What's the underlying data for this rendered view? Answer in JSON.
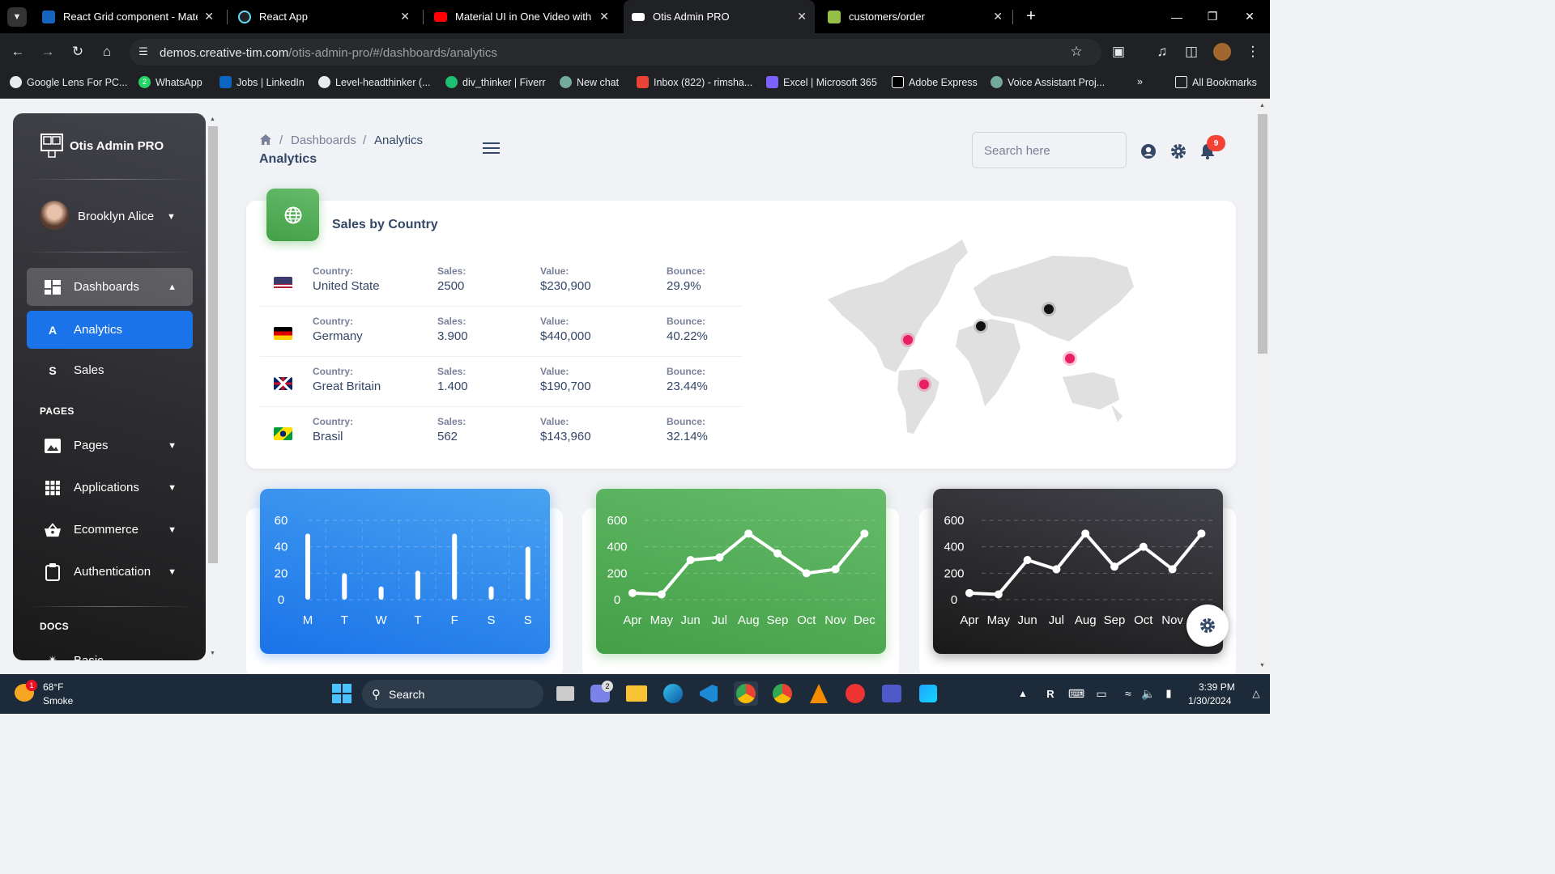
{
  "browser": {
    "tabs": [
      {
        "title": "React Grid component - Materia",
        "active": false
      },
      {
        "title": "React App",
        "active": false
      },
      {
        "title": "Material UI in One Video with R",
        "active": false
      },
      {
        "title": "Otis Admin PRO",
        "active": true
      },
      {
        "title": "customers/order",
        "active": false
      }
    ],
    "url_host": "demos.creative-tim.com",
    "url_path": "/otis-admin-pro/#/dashboards/analytics",
    "bookmarks": [
      "Google Lens For PC...",
      "WhatsApp",
      "Jobs | LinkedIn",
      "Level-headthinker (...",
      "div_thinker | Fiverr",
      "New chat",
      "Inbox (822) - rimsha...",
      "Excel | Microsoft 365",
      "Adobe Express",
      "Voice Assistant Proj..."
    ],
    "all_bookmarks": "All Bookmarks",
    "whatsapp_badge": "2"
  },
  "sidenav": {
    "brand": "Otis Admin PRO",
    "user": "Brooklyn Alice",
    "dashboards": "Dashboards",
    "sub": [
      {
        "letter": "A",
        "label": "Analytics"
      },
      {
        "letter": "S",
        "label": "Sales"
      }
    ],
    "pages_heading": "PAGES",
    "pages": [
      "Pages",
      "Applications",
      "Ecommerce",
      "Authentication"
    ],
    "docs_heading": "DOCS",
    "docs_first": "Basic"
  },
  "header": {
    "crumb_dashboards": "Dashboards",
    "crumb_sep": "/",
    "crumb_current": "Analytics",
    "title": "Analytics",
    "search_placeholder": "Search here",
    "notification_count": "9"
  },
  "sales_by_country": {
    "title": "Sales by Country",
    "labels": {
      "country": "Country:",
      "sales": "Sales:",
      "value": "Value:",
      "bounce": "Bounce:"
    },
    "rows": [
      {
        "country": "United State",
        "sales": "2500",
        "value": "$230,900",
        "bounce": "29.9%"
      },
      {
        "country": "Germany",
        "sales": "3.900",
        "value": "$440,000",
        "bounce": "40.22%"
      },
      {
        "country": "Great Britain",
        "sales": "1.400",
        "value": "$190,700",
        "bounce": "23.44%"
      },
      {
        "country": "Brasil",
        "sales": "562",
        "value": "$143,960",
        "bounce": "32.14%"
      }
    ]
  },
  "chart_data": [
    {
      "type": "bar",
      "categories": [
        "M",
        "T",
        "W",
        "T",
        "F",
        "S",
        "S"
      ],
      "values": [
        50,
        20,
        10,
        22,
        50,
        10,
        40
      ],
      "ylim": [
        0,
        60
      ],
      "yticks": [
        0,
        20,
        40,
        60
      ],
      "color": "#1a73e8"
    },
    {
      "type": "line",
      "categories": [
        "Apr",
        "May",
        "Jun",
        "Jul",
        "Aug",
        "Sep",
        "Oct",
        "Nov",
        "Dec"
      ],
      "values": [
        50,
        40,
        300,
        320,
        500,
        350,
        200,
        230,
        500
      ],
      "ylim": [
        0,
        600
      ],
      "yticks": [
        0,
        200,
        400,
        600
      ],
      "color": "#4caf50"
    },
    {
      "type": "line",
      "categories": [
        "Apr",
        "May",
        "Jun",
        "Jul",
        "Aug",
        "Sep",
        "Oct",
        "Nov",
        "Dec"
      ],
      "values": [
        50,
        40,
        300,
        230,
        500,
        250,
        400,
        230,
        500
      ],
      "ylim": [
        0,
        600
      ],
      "yticks": [
        0,
        200,
        400,
        600
      ],
      "color": "#262626"
    }
  ],
  "taskbar": {
    "weather_temp": "68°F",
    "weather_desc": "Smoke",
    "weather_badge": "1",
    "search": "Search",
    "teams_badge": "2",
    "time": "3:39 PM",
    "date": "1/30/2024"
  }
}
